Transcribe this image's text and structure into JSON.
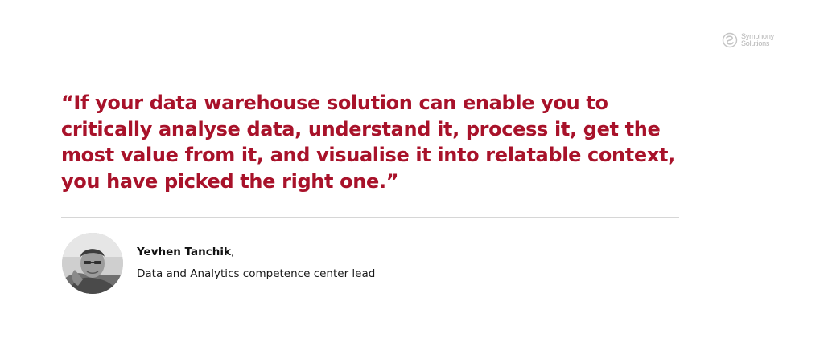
{
  "brand": {
    "logo_line1": "Symphony",
    "logo_line2": "Solutions",
    "logo_icon": "symphony-swirl-icon"
  },
  "quote": {
    "text": "“If your data warehouse solution can enable you to critically analyse data, understand it, process it, get the most value from it, and visualise it into relatable context, you have picked the right one.”",
    "color": "#a8122a"
  },
  "author": {
    "name": "Yevhen Tanchik",
    "name_suffix": ",",
    "role": "Data and Analytics competence center lead",
    "photo_icon": "avatar-portrait"
  }
}
